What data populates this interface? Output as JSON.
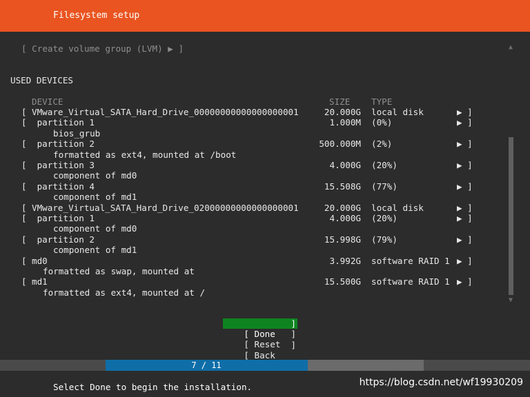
{
  "header": {
    "title": "Filesystem setup"
  },
  "create_vg": "[ Create volume group (LVM) ▶ ]",
  "section_title": "USED DEVICES",
  "columns": {
    "device": "DEVICE",
    "size": "SIZE",
    "type": "TYPE"
  },
  "rows": [
    {
      "bracket": "[",
      "name": "VMware_Virtual_SATA_Hard_Drive_00000000000000000001",
      "size": "20.000G",
      "type": "local disk",
      "arrow": "▶ ]"
    },
    {
      "bracket": "[",
      "name": " partition 1",
      "size": "1.000M",
      "type": "(0%)",
      "arrow": "▶ ]"
    },
    {
      "sub": "bios_grub"
    },
    {
      "bracket": "[",
      "name": " partition 2",
      "size": "500.000M",
      "type": "(2%)",
      "arrow": "▶ ]"
    },
    {
      "sub": "formatted as ext4, mounted at /boot"
    },
    {
      "bracket": "[",
      "name": " partition 3",
      "size": "4.000G",
      "type": "(20%)",
      "arrow": "▶ ]"
    },
    {
      "sub": "component of md0"
    },
    {
      "bracket": "[",
      "name": " partition 4",
      "size": "15.508G",
      "type": "(77%)",
      "arrow": "▶ ]"
    },
    {
      "sub": "component of md1"
    },
    {
      "bracket": "[",
      "name": "VMware_Virtual_SATA_Hard_Drive_02000000000000000001",
      "size": "20.000G",
      "type": "local disk",
      "arrow": "▶ ]"
    },
    {
      "bracket": "[",
      "name": " partition 1",
      "size": "4.000G",
      "type": "(20%)",
      "arrow": "▶ ]"
    },
    {
      "sub": "component of md0"
    },
    {
      "bracket": "[",
      "name": " partition 2",
      "size": "15.998G",
      "type": "(79%)",
      "arrow": "▶ ]"
    },
    {
      "sub": "component of md1"
    },
    {
      "bracket": "[",
      "name": "md0",
      "size": "3.992G",
      "type": "software RAID 1",
      "arrow": "▶ ]"
    },
    {
      "mdsub": "formatted as swap, mounted at"
    },
    {
      "bracket": "[",
      "name": "md1",
      "size": "15.500G",
      "type": "software RAID 1",
      "arrow": "▶ ]"
    },
    {
      "mdsub": "formatted as ext4, mounted at /"
    }
  ],
  "buttons": {
    "done": "[ Done",
    "reset": "[ Reset",
    "back": "[ Back",
    "close": "]"
  },
  "scroll": {
    "up": "▲",
    "down": "▼"
  },
  "progress": {
    "label": "7 / 11",
    "current": 7,
    "total": 11
  },
  "footer": {
    "text": "Select Done to begin the installation."
  },
  "watermark": "https://blog.csdn.net/wf19930209",
  "colors": {
    "header": "#e95420",
    "focus": "#0e8420",
    "progress": "#0f6ea8"
  }
}
